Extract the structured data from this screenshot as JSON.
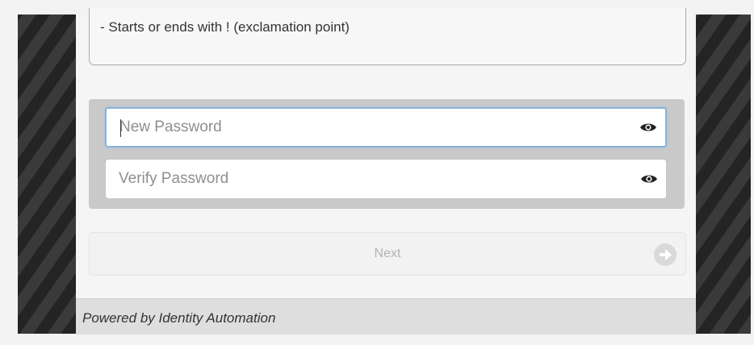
{
  "password_rules": {
    "visible_rule": "- Starts or ends with ! (exclamation point)"
  },
  "form": {
    "new_password": {
      "value": "",
      "placeholder": "New Password",
      "toggle_icon": "eye-icon"
    },
    "verify_password": {
      "value": "",
      "placeholder": "Verify Password",
      "toggle_icon": "eye-icon"
    },
    "next_button": {
      "label": "Next",
      "icon": "arrow-right-circle-icon",
      "state": "disabled"
    }
  },
  "footer": {
    "text": "Powered by Identity Automation"
  },
  "colors": {
    "focus_border": "#8db3d6",
    "field_group_bg": "#c9c9c9",
    "background_stripes": "#2a2a2a"
  }
}
